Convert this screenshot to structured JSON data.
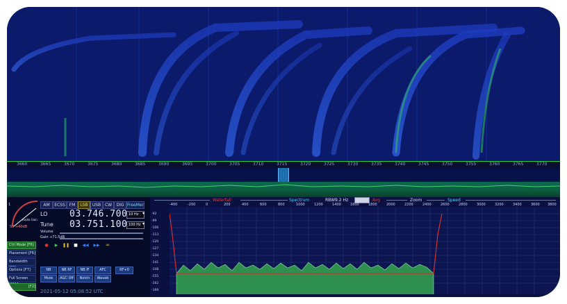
{
  "top_axis": {
    "ticks": [
      "3660",
      "3665",
      "3670",
      "3675",
      "3680",
      "3685",
      "3690",
      "3695",
      "3700",
      "3705",
      "3710",
      "3715",
      "3720",
      "3725",
      "3730",
      "3735",
      "3740",
      "3745",
      "3750",
      "3755",
      "3760",
      "3765",
      "3770"
    ]
  },
  "modes": [
    "AM",
    "ECSS",
    "FM",
    "LSB",
    "USB",
    "CW",
    "DIG",
    "FreeMer"
  ],
  "active_mode": "LSB",
  "lo": {
    "label": "LO",
    "value": "03.746.700",
    "step": "10 Hz"
  },
  "tune": {
    "label": "Tune",
    "value": "03.751.100",
    "step": "100 Hz"
  },
  "volume": {
    "label": "Volume",
    "gain": "Gain +71.5dB"
  },
  "s_meter": {
    "label": "Audio Gain",
    "scale_left": "1",
    "scale_right": "S9 +40dB"
  },
  "left_buttons": [
    {
      "label": "Ctrl Mode  [F6]",
      "highlight": true
    },
    {
      "label": "Placement  [F6]",
      "highlight": false
    },
    {
      "label": "Bandwidth  [F8]",
      "highlight": false
    },
    {
      "label": "Options  [F7]",
      "highlight": false
    },
    {
      "label": "Full Screen  [F11]",
      "highlight": false
    },
    {
      "label": "[F2]",
      "highlight": true
    }
  ],
  "dsp_row1": [
    "NB",
    "NB RF",
    "NB IF",
    "AFC",
    "RF+0"
  ],
  "dsp_row2": [
    "Mute",
    "AGC Off",
    "Notch",
    "Waveb"
  ],
  "utc": "2021-05-12  05:08:52 UTC",
  "spectrum_header": {
    "waterfall": "Waterfall",
    "spectrum": "Spectrum",
    "rbw_label": "RBW",
    "rbw_value": "9.2 Hz",
    "avg": "Avg",
    "zoom": "Zoom",
    "speed": "Speed"
  },
  "spectrum_axis": {
    "x_ticks": [
      "-400",
      "-200",
      "0",
      "200",
      "400",
      "600",
      "800",
      "1000",
      "1200",
      "1400",
      "1600",
      "1800",
      "2000",
      "2200",
      "2400",
      "2600",
      "2800",
      "3000",
      "3200",
      "3400",
      "3600",
      "3800"
    ],
    "y_ticks": [
      "-92",
      "-99",
      "-106",
      "-113",
      "-120",
      "-127",
      "-134",
      "-141",
      "-148",
      "-155",
      "-162",
      "-169"
    ]
  },
  "colors": {
    "waterfall_bg": "#0b1a6a",
    "spectrum_fill": "#2f8f4f",
    "passband": "#c03030",
    "accent": "#2ecc40"
  }
}
